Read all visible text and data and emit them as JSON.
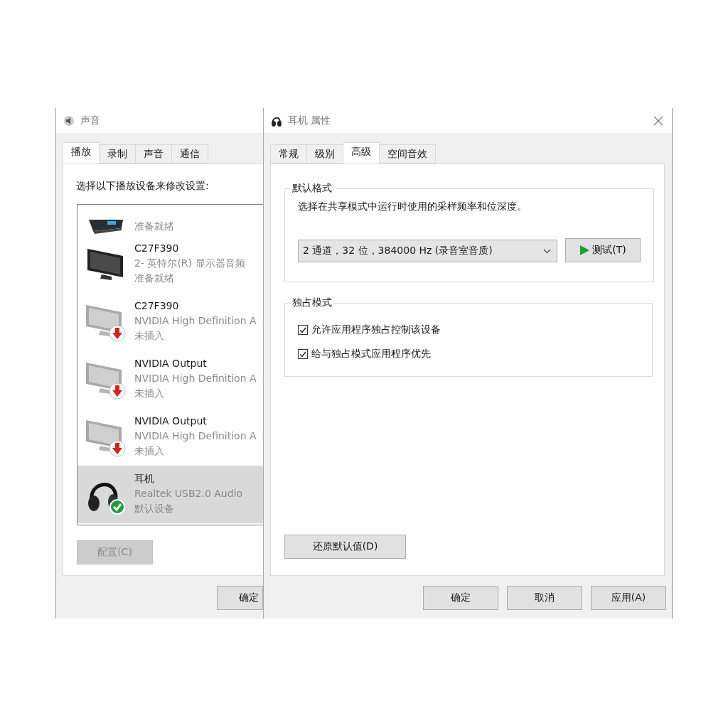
{
  "sound_window": {
    "title": "声音",
    "tabs": [
      {
        "label": "播放",
        "selected": true
      },
      {
        "label": "录制",
        "selected": false
      },
      {
        "label": "声音",
        "selected": false
      },
      {
        "label": "通信",
        "selected": false
      }
    ],
    "instruction": "选择以下播放设备来修改设置:",
    "devices": [
      {
        "kind": "receiver",
        "status": "准备就绪",
        "selected": false
      },
      {
        "kind": "monitor",
        "name": "C27F390",
        "description": "2- 英特尔(R) 显示器音频",
        "status": "准备就绪",
        "selected": false
      },
      {
        "kind": "unplugged-monitor",
        "name": "C27F390",
        "description": "NVIDIA High Definition A",
        "status": "未插入",
        "selected": false
      },
      {
        "kind": "unplugged-monitor",
        "name": "NVIDIA Output",
        "description": "NVIDIA High Definition A",
        "status": "未插入",
        "selected": false
      },
      {
        "kind": "unplugged-monitor",
        "name": "NVIDIA Output",
        "description": "NVIDIA High Definition A",
        "status": "未插入",
        "selected": false
      },
      {
        "kind": "default-headphones",
        "name": "耳机",
        "description": "Realtek USB2.0 Audio",
        "status": "默认设备",
        "selected": true
      }
    ],
    "configure_button": {
      "label": "配置(C)",
      "disabled": true
    },
    "ok_button": {
      "label": "确定"
    }
  },
  "properties_window": {
    "title": "耳机 属性",
    "tabs": [
      {
        "label": "常规",
        "selected": false
      },
      {
        "label": "级别",
        "selected": false
      },
      {
        "label": "高级",
        "selected": true
      },
      {
        "label": "空间音效",
        "selected": false
      }
    ],
    "default_format": {
      "title": "默认格式",
      "description": "选择在共享模式中运行时使用的采样频率和位深度。",
      "format_dropdown": {
        "value": "2 通道，32 位，384000 Hz (录音室音质)"
      },
      "test_button": {
        "label": "测试(T)"
      }
    },
    "exclusive_mode": {
      "title": "独占模式",
      "options": [
        {
          "label": "允许应用程序独占控制该设备",
          "checked": true
        },
        {
          "label": "给与独占模式应用程序优先",
          "checked": true
        }
      ]
    },
    "restore_button": {
      "label": "还原默认值(D)"
    },
    "buttons": [
      {
        "label": "确定"
      },
      {
        "label": "取消"
      },
      {
        "label": "应用(A)"
      }
    ]
  }
}
